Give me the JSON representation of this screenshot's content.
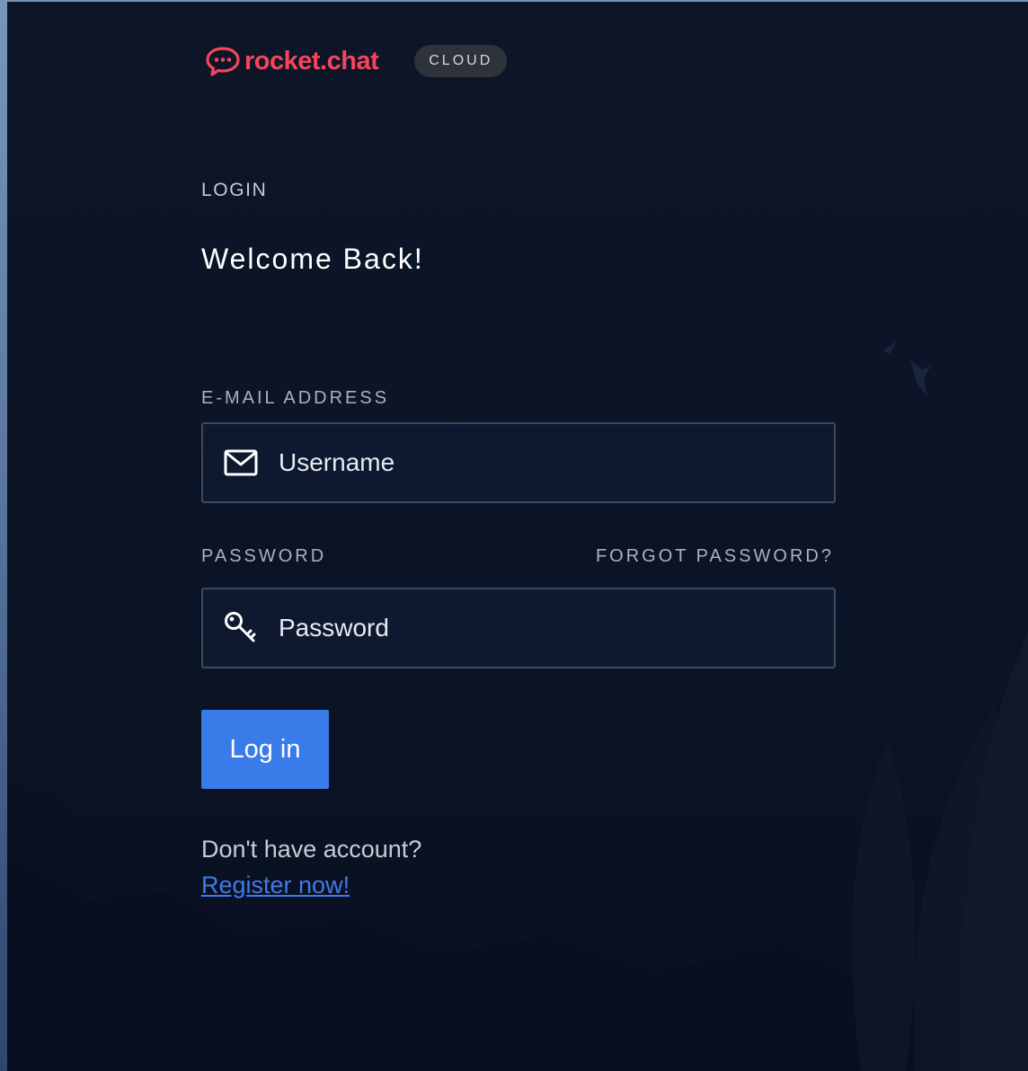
{
  "header": {
    "logo_text": "rocket.chat",
    "badge": "CLOUD"
  },
  "form": {
    "section_label": "LOGIN",
    "welcome": "Welcome Back!",
    "email_label": "E-MAIL ADDRESS",
    "email_placeholder": "Username",
    "password_label": "PASSWORD",
    "forgot_password": "FORGOT PASSWORD?",
    "password_placeholder": "Password",
    "login_button": "Log in",
    "no_account": "Don't have account?",
    "register_link": "Register now!"
  },
  "icons": {
    "logo": "rocket-chat-logo-icon",
    "email": "envelope-icon",
    "password": "key-icon"
  },
  "colors": {
    "brand": "#f5455c",
    "button": "#3a7bea",
    "link": "#3f7bea",
    "panel": "#0b1426"
  }
}
